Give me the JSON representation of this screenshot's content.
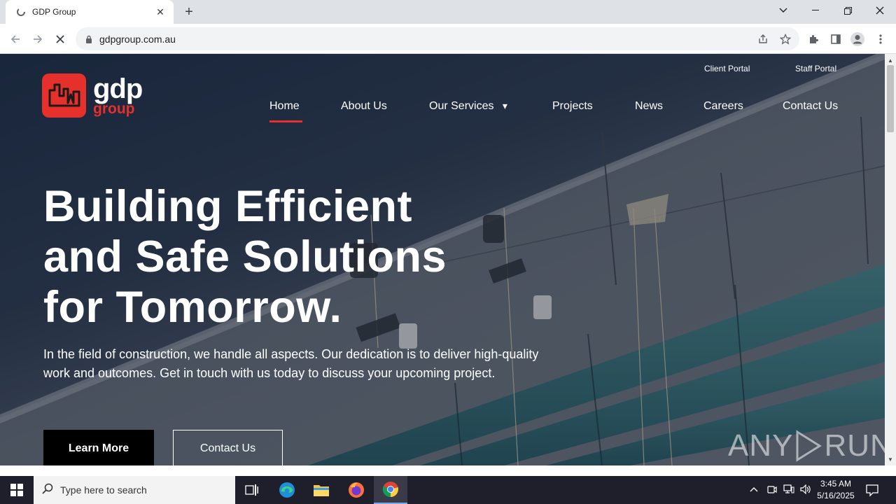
{
  "browser": {
    "tab_title": "GDP Group",
    "tab_close": "✕",
    "new_tab": "+",
    "url": "gdpgroup.com.au"
  },
  "site": {
    "logo_primary": "gdp",
    "logo_secondary": "group",
    "portals": {
      "client": "Client Portal",
      "staff": "Staff Portal"
    },
    "nav": [
      "Home",
      "About Us",
      "Our Services",
      "Projects",
      "News",
      "Careers",
      "Contact Us"
    ],
    "nav_dropdown_caret": "▾",
    "hero": {
      "title_lines": [
        "Building Efficient",
        "and Safe Solutions",
        "for Tomorrow."
      ],
      "description": "In the field of construction, we handle all aspects. Our dedication is to deliver high-quality work and outcomes. Get in touch with us today to discuss your upcoming project.",
      "learn_more": "Learn More",
      "contact_us": "Contact Us"
    },
    "watermark_left": "ANY",
    "watermark_right": "RUN"
  },
  "taskbar": {
    "search_placeholder": "Type here to search",
    "time": "3:45 AM",
    "date": "5/16/2025"
  },
  "colors": {
    "brand_red": "#e5302b",
    "hero_dark": "#1c2a40",
    "taskbar": "#1f1f2b"
  }
}
